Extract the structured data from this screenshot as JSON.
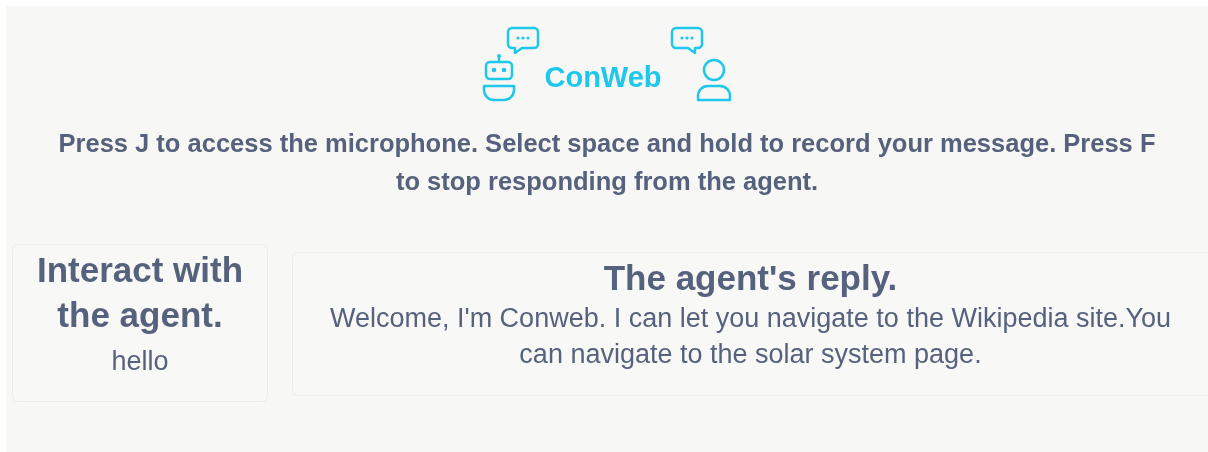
{
  "logo": {
    "text": "ConWeb"
  },
  "instructions": "Press J to access the microphone. Select space and hold to record your message. Press F to stop responding from the agent.",
  "user_panel": {
    "title": "Interact with the agent.",
    "message": "hello"
  },
  "agent_panel": {
    "title": "The agent's reply.",
    "message": "Welcome, I'm Conweb. I can let you navigate to the Wikipedia site.You can navigate to the solar system page."
  }
}
